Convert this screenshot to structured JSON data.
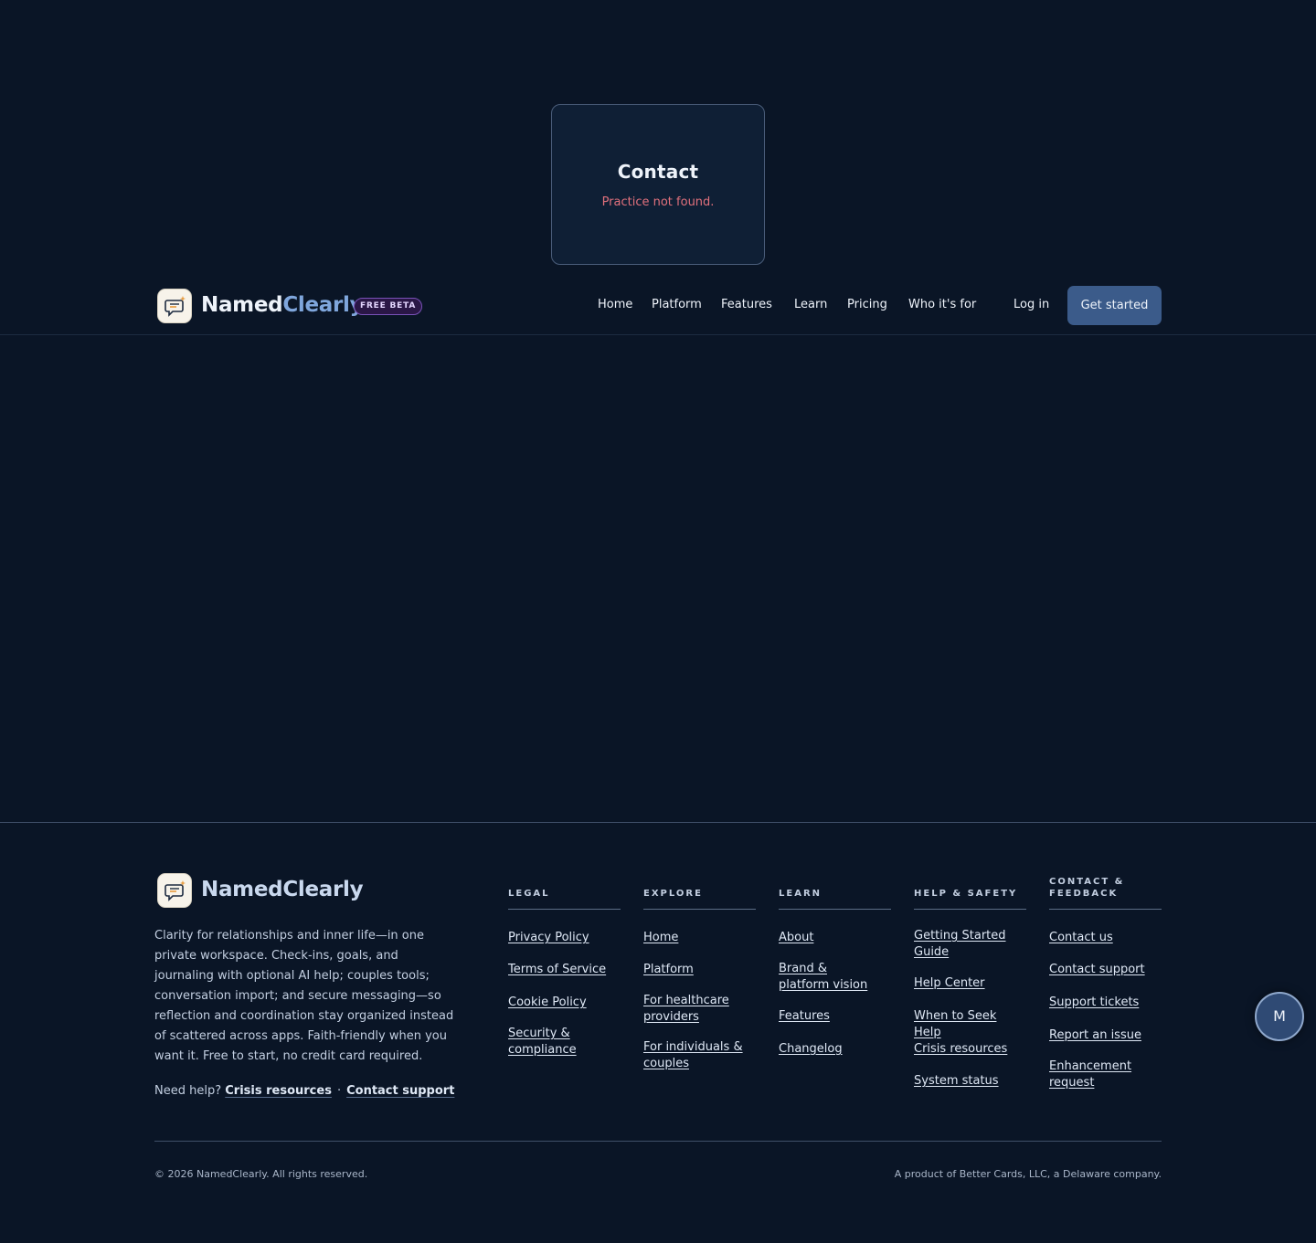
{
  "card": {
    "title": "Contact",
    "message": "Practice not found."
  },
  "brand": {
    "part1": "Named",
    "part2": "Clearly",
    "badge": "FREE BETA"
  },
  "nav": {
    "links": [
      "Home",
      "Platform",
      "Features",
      "Learn",
      "Pricing",
      "Who it's for"
    ],
    "login": "Log in",
    "cta": "Get started"
  },
  "footer": {
    "tagline": "Clarity for relationships and inner life—in one private workspace. Check-ins, goals, and journaling with optional AI help; couples tools; conversation import; and secure messaging—so reflection and coordination stay organized instead of scattered across apps. Faith-friendly when you want it. Free to start, no credit card required.",
    "need_help": "Need help?",
    "crisis_link": "Crisis resources",
    "separator": "·",
    "support_link": "Contact support",
    "columns": [
      {
        "heading": "LEGAL",
        "links": [
          "Privacy Policy",
          "Terms of Service",
          "Cookie Policy",
          "Security & compliance"
        ]
      },
      {
        "heading": "EXPLORE",
        "links": [
          "Home",
          "Platform",
          "For healthcare providers",
          "For individuals & couples"
        ]
      },
      {
        "heading": "LEARN",
        "links": [
          "About",
          "Brand & platform vision",
          "Features",
          "Changelog"
        ]
      },
      {
        "heading": "HELP & SAFETY",
        "links": [
          "Getting Started Guide",
          "Help Center",
          "When to Seek Help",
          "Crisis resources",
          "System status"
        ]
      },
      {
        "heading": "CONTACT & FEEDBACK",
        "links": [
          "Contact us",
          "Contact support",
          "Support tickets",
          "Report an issue",
          "Enhancement request"
        ]
      }
    ],
    "copyright": "© 2026 NamedClearly. All rights reserved.",
    "product": "A product of Better Cards, LLC, a Delaware company."
  },
  "avatar": {
    "initial": "M"
  },
  "colors": {
    "background": "#0a1526",
    "accent": "#7fa6dc",
    "cta": "#3b5b8a",
    "error": "#e0707c",
    "beta": "#7a52b8"
  }
}
